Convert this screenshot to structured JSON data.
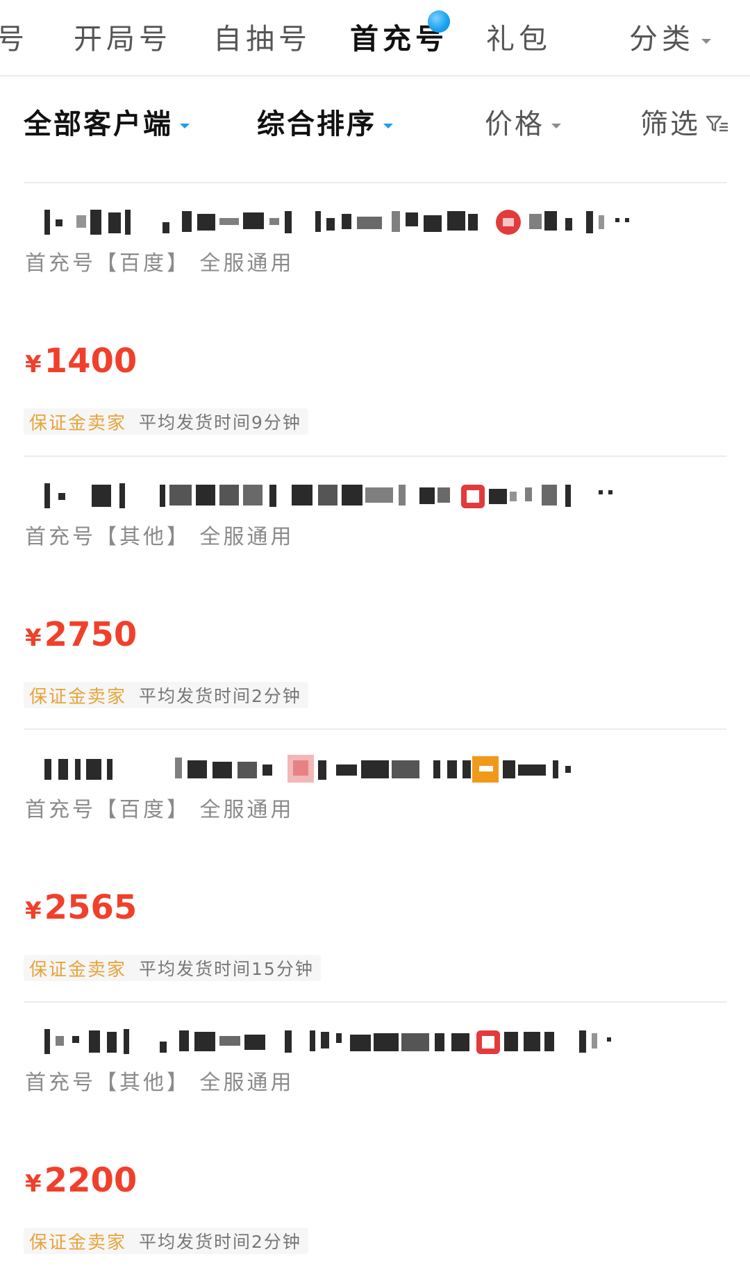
{
  "top_tabs": [
    {
      "label": "号"
    },
    {
      "label": "开局号"
    },
    {
      "label": "自抽号"
    },
    {
      "label": "首充号",
      "active": true
    },
    {
      "label": "礼包"
    },
    {
      "label": "分类"
    }
  ],
  "filters": {
    "client": "全部客户端",
    "sort": "综合排序",
    "price": "价格",
    "filter": "筛选"
  },
  "listings": [
    {
      "subtitle": "首充号【百度】 全服通用",
      "currency": "¥",
      "price": "1400",
      "deposit_badge": "保证金卖家",
      "delivery_time": "平均发货时间9分钟"
    },
    {
      "subtitle": "首充号【其他】 全服通用",
      "currency": "¥",
      "price": "2750",
      "deposit_badge": "保证金卖家",
      "delivery_time": "平均发货时间2分钟"
    },
    {
      "subtitle": "首充号【百度】 全服通用",
      "currency": "¥",
      "price": "2565",
      "deposit_badge": "保证金卖家",
      "delivery_time": "平均发货时间15分钟"
    },
    {
      "subtitle": "首充号【其他】 全服通用",
      "currency": "¥",
      "price": "2200",
      "deposit_badge": "保证金卖家",
      "delivery_time": "平均发货时间2分钟"
    }
  ],
  "colors": {
    "price_red": "#f0402b",
    "deposit_orange": "#e8a33a",
    "accent_blue": "#1b9cf2"
  }
}
